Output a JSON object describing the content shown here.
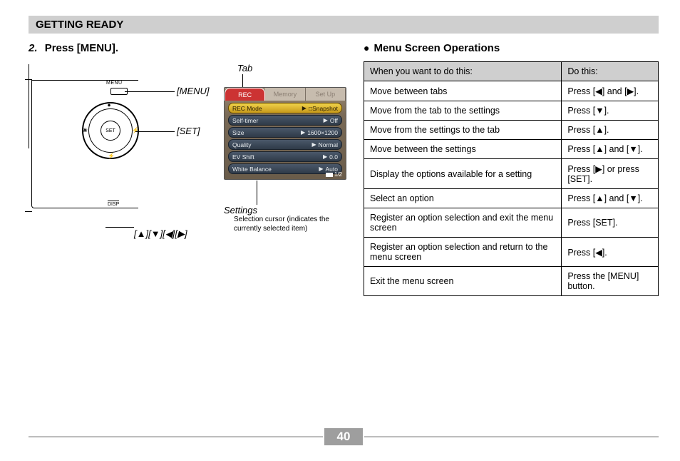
{
  "section_header": "GETTING READY",
  "step": {
    "number": "2.",
    "text": "Press [MENU]."
  },
  "diagram": {
    "menu_small": "MENU",
    "set_small": "SET",
    "disp_small": "DISP",
    "label_menu": "[MENU]",
    "label_set": "[SET]",
    "label_keys": "[▲][▼][◀][▶]",
    "label_tab": "Tab",
    "label_settings": "Settings",
    "cursor_note": "Selection cursor (indicates the currently selected item)"
  },
  "menu_screen": {
    "tabs": [
      "REC",
      "Memory",
      "Set Up"
    ],
    "active_tab_index": 0,
    "rows": [
      {
        "k": "REC Mode",
        "v": "□Snapshot",
        "sel": true
      },
      {
        "k": "Self-timer",
        "v": "Off"
      },
      {
        "k": "Size",
        "v": "1600×1200"
      },
      {
        "k": "Quality",
        "v": "Normal"
      },
      {
        "k": "EV Shift",
        "v": "0.0"
      },
      {
        "k": "White Balance",
        "v": "Auto"
      }
    ],
    "footer": "1/2"
  },
  "ops": {
    "title": "Menu Screen Operations",
    "head": [
      "When you want to do this:",
      "Do this:"
    ],
    "rows": [
      [
        "Move between tabs",
        "Press [◀] and [▶]."
      ],
      [
        "Move from the tab to the settings",
        "Press [▼]."
      ],
      [
        "Move from the settings to the tab",
        "Press [▲]."
      ],
      [
        "Move between the settings",
        "Press [▲] and [▼]."
      ],
      [
        "Display the options available for a setting",
        "Press [▶] or press [SET]."
      ],
      [
        "Select an option",
        "Press [▲] and [▼]."
      ],
      [
        "Register an option selection and exit the menu screen",
        "Press [SET]."
      ],
      [
        "Register an option selection and return to the menu screen",
        "Press [◀]."
      ],
      [
        "Exit the menu screen",
        "Press the [MENU] button."
      ]
    ]
  },
  "page_number": "40",
  "glyphs": {
    "up": "▲",
    "down": "▼",
    "left": "◀",
    "right": "▶",
    "play": "▶"
  }
}
